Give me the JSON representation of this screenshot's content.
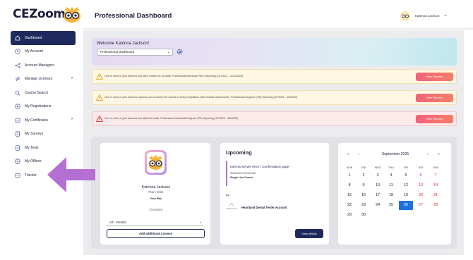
{
  "app": {
    "logo_text": "CEZoom",
    "page_title": "Professional Dashboard"
  },
  "user": {
    "name": "Katrinna Jackson"
  },
  "sidebar": {
    "items": [
      {
        "label": "Dashboard",
        "icon": "home-icon"
      },
      {
        "label": "My Account",
        "icon": "user-icon"
      },
      {
        "label": "Account Managers",
        "icon": "network-icon"
      },
      {
        "label": "Manage Licenses",
        "icon": "license-icon"
      },
      {
        "label": "Course Search",
        "icon": "search-icon"
      },
      {
        "label": "My Registrations",
        "icon": "registration-icon"
      },
      {
        "label": "My Certificates",
        "icon": "certificate-icon"
      },
      {
        "label": "My Surveys",
        "icon": "survey-icon"
      },
      {
        "label": "My Tests",
        "icon": "test-icon"
      },
      {
        "label": "My Offices",
        "icon": "office-icon"
      },
      {
        "label": "Tracker",
        "icon": "tracker-icon"
      }
    ]
  },
  "welcome": {
    "title": "Welcome Katrinna Jackson!",
    "dashboard_select": "Professional Dashboard"
  },
  "alerts": [
    {
      "type": "warning",
      "text": "One or more of your licenses has been chosen for an audit.  Professional Individual PELE Wyoming (1/1/2023 - 12/31/2024)",
      "button": "View Records"
    },
    {
      "type": "warning",
      "text": "One or more of your licenses requires you to submit CE records to verify compliance with renewal requirements.  Professional Engineer (PE) Wyoming (3/7/2021 - 3/6/2023)",
      "button": "View Records"
    },
    {
      "type": "danger",
      "text": "One or more of your licenses has failed the audit.  Professional Individual Engineer (PE) Wyoming (3/7/2023 - 3/6/2025)",
      "button": "View Records"
    }
  ],
  "profile": {
    "name": "Katrinna Jackson",
    "plan": "Plan: Elite",
    "view_plan": "View Plan",
    "profession": "Dentistry",
    "license_select": "AZ - Dentist",
    "add_license": "Add additional License"
  },
  "upcoming": {
    "title": "Upcoming",
    "event_title": "Internal server error | Confirmation page",
    "event_date": "9/26/2025 9:00:00 AM",
    "event_type": "Single Live Course",
    "by_label": "By:",
    "provider_logo_text": "HEARTLAND",
    "provider": "Heartland Dental Tester Account",
    "view_details": "View details"
  },
  "calendar": {
    "month": "September 2025",
    "nav_prev_year": "«",
    "nav_prev": "‹",
    "nav_next": "›",
    "nav_next_year": "»",
    "weekdays": [
      "MON",
      "TUE",
      "WED",
      "THU",
      "FRI",
      "SAT",
      "SUN"
    ],
    "weeks": [
      [
        "1",
        "2",
        "3",
        "4",
        "5",
        "6",
        "7"
      ],
      [
        "8",
        "9",
        "10",
        "11",
        "12",
        "13",
        "14"
      ],
      [
        "15",
        "16",
        "17",
        "18",
        "19",
        "20",
        "21"
      ],
      [
        "22",
        "23",
        "24",
        "25",
        "26",
        "27",
        "28"
      ],
      [
        "29",
        "30",
        "",
        "",
        "",
        "",
        ""
      ]
    ],
    "selected_day": "26"
  },
  "colors": {
    "navy": "#1e2a5e",
    "alert_button": "#f2637b",
    "today": "#1d6fdc",
    "weekend": "#e0282e",
    "arrow": "#b46fd2"
  }
}
